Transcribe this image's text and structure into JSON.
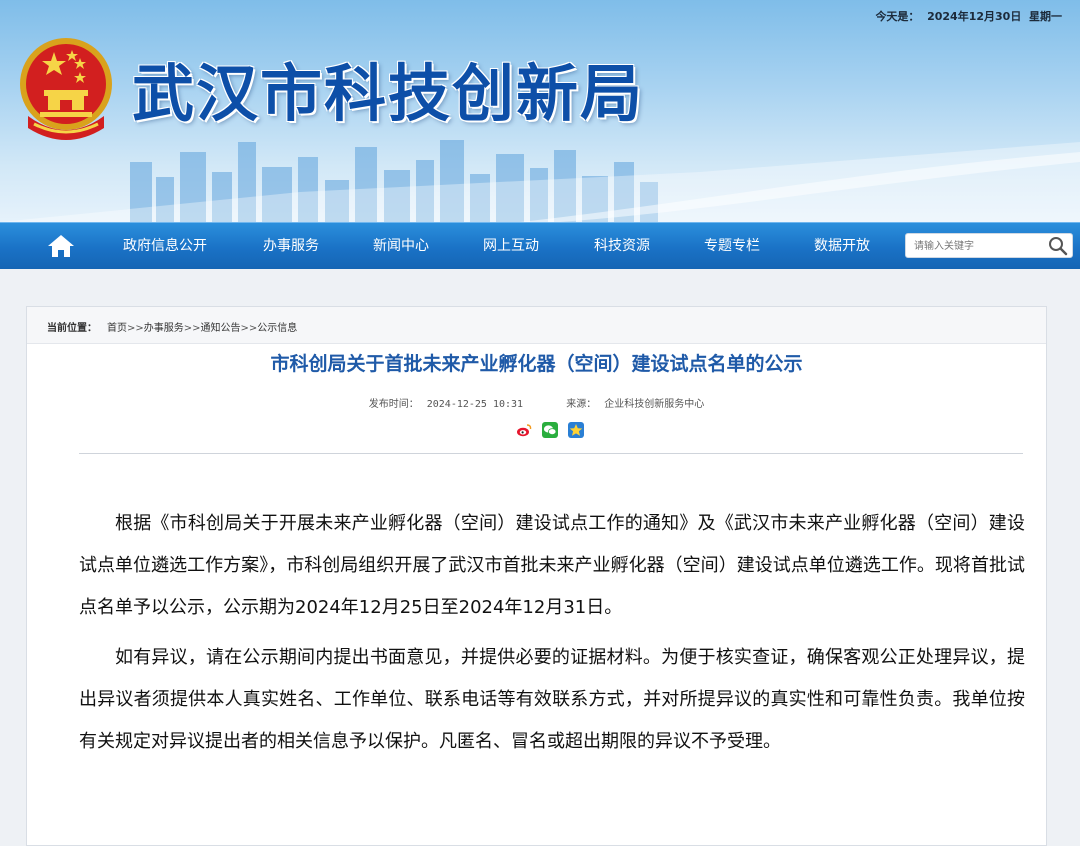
{
  "header": {
    "date_text": "今天是：  2024年12月30日  星期一",
    "site_title": "武汉市科技创新局"
  },
  "nav": {
    "home_icon": "home-icon",
    "items": [
      "政府信息公开",
      "办事服务",
      "新闻中心",
      "网上互动",
      "科技资源",
      "专题专栏",
      "数据开放"
    ],
    "search_placeholder": "请输入关键字",
    "search_icon": "search-icon"
  },
  "breadcrumb": {
    "label": "当前位置：",
    "items": [
      "首页",
      "办事服务",
      "通知公告",
      "公示信息"
    ],
    "separator": ">>"
  },
  "article": {
    "title": "市科创局关于首批未来产业孵化器（空间）建设试点名单的公示",
    "publish_label": "发布时间：",
    "publish_time": "2024-12-25 10:31",
    "source_label": "来源：",
    "source": "企业科技创新服务中心",
    "share_icons": [
      "weibo-icon",
      "wechat-icon",
      "qzone-icon"
    ],
    "paragraphs": [
      "根据《市科创局关于开展未来产业孵化器（空间）建设试点工作的通知》及《武汉市未来产业孵化器（空间）建设试点单位遴选工作方案》，市科创局组织开展了武汉市首批未来产业孵化器（空间）建设试点单位遴选工作。现将首批试点名单予以公示，公示期为2024年12月25日至2024年12月31日。",
      "如有异议，请在公示期间内提出书面意见，并提供必要的证据材料。为便于核实查证，确保客观公正处理异议，提出异议者须提供本人真实姓名、工作单位、联系电话等有效联系方式，并对所提异议的真实性和可靠性负责。我单位按有关规定对异议提出者的相关信息予以保护。凡匿名、冒名或超出期限的异议不予受理。"
    ]
  },
  "colors": {
    "brand_blue": "#0d4fa8",
    "nav_blue": "#1a72c6",
    "title_blue": "#1f5aa8"
  }
}
